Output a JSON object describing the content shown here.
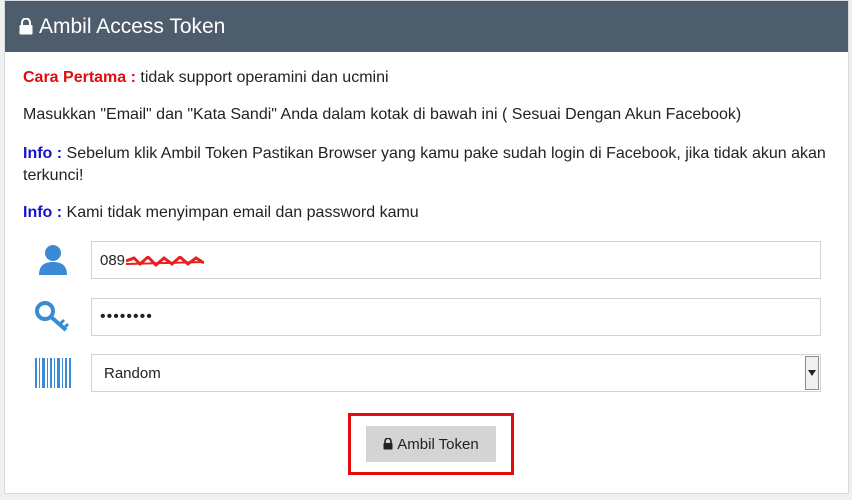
{
  "header": {
    "title": "Ambil Access Token",
    "icon": "lock-icon"
  },
  "info": {
    "line1_label": "Cara Pertama :",
    "line1_text": " tidak support operamini dan ucmini",
    "line2_text": "Masukkan \"Email\" dan \"Kata Sandi\" Anda dalam kotak di bawah ini ( Sesuai Dengan Akun Facebook)",
    "line3_label": "Info :",
    "line3_text": " Sebelum klik Ambil Token Pastikan Browser yang kamu pake sudah login di Facebook, jika tidak akun akan terkunci!",
    "line4_label": "Info :",
    "line4_text": " Kami tidak menyimpan email dan password kamu"
  },
  "form": {
    "email_value": "089",
    "email_icon": "user-icon",
    "password_value": "••••••••",
    "password_icon": "key-icon",
    "device_value": "Random",
    "device_icon": "barcode-icon"
  },
  "button": {
    "label": "Ambil Token",
    "icon": "lock-icon"
  },
  "colors": {
    "header_bg": "#4e5d6c",
    "red_label": "#e20c0c",
    "blue_label": "#1414c8",
    "icon_blue": "#3a8ad6",
    "highlight_border": "#e20c0c"
  }
}
